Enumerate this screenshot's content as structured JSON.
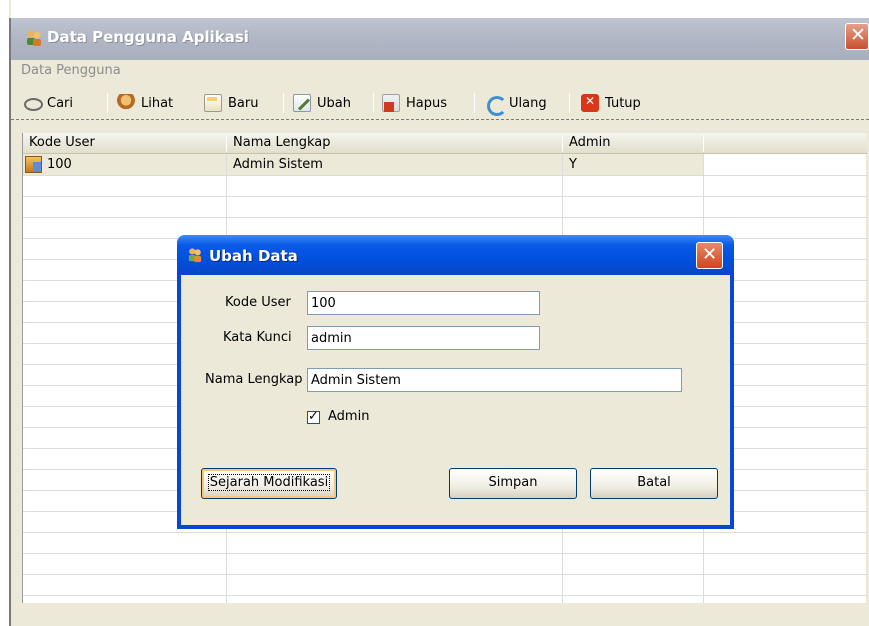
{
  "window": {
    "title": "Data Pengguna Aplikasi",
    "close_glyph": "✕",
    "icon": "users-icon"
  },
  "menu": {
    "label": "Data Pengguna"
  },
  "toolbar": {
    "items": [
      {
        "label": "Cari",
        "icon": "binoculars-icon"
      },
      {
        "label": "Lihat",
        "icon": "user-view-icon"
      },
      {
        "label": "Baru",
        "icon": "new-document-icon"
      },
      {
        "label": "Ubah",
        "icon": "edit-icon"
      },
      {
        "label": "Hapus",
        "icon": "delete-icon"
      },
      {
        "label": "Ulang",
        "icon": "refresh-icon"
      },
      {
        "label": "Tutup",
        "icon": "close-icon"
      }
    ]
  },
  "grid": {
    "columns": [
      "Kode User",
      "Nama Lengkap",
      "Admin"
    ],
    "rows": [
      {
        "kode_user": "100",
        "nama_lengkap": "Admin Sistem",
        "admin": "Y"
      }
    ]
  },
  "dialog": {
    "title": "Ubah Data",
    "close_glyph": "✕",
    "fields": {
      "kode_user_label": "Kode User",
      "kode_user_value": "100",
      "kata_kunci_label": "Kata Kunci",
      "kata_kunci_value": "admin",
      "nama_lengkap_label": "Nama Lengkap",
      "nama_lengkap_value": "Admin Sistem"
    },
    "admin_checkbox": {
      "label": "Admin",
      "checked": true
    },
    "buttons": {
      "history": "Sejarah Modifikasi",
      "save": "Simpan",
      "cancel": "Batal"
    }
  }
}
